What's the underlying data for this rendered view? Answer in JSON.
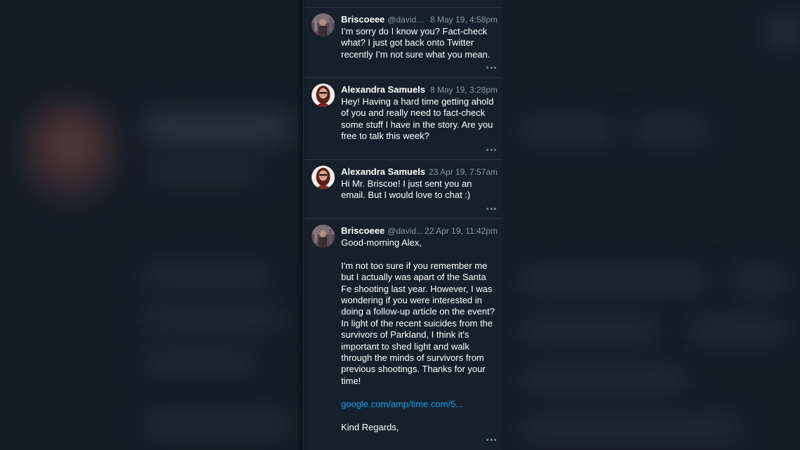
{
  "colors": {
    "background": "#15202b",
    "text": "#ffffff",
    "muted": "#8899a6",
    "link": "#1da1f2",
    "divider": "#2b3640"
  },
  "conversation": [
    {
      "name": "Briscoeee",
      "handle": "@davidd...",
      "date": "8 May 19, 4:58pm",
      "avatar": "briscoe-avatar",
      "text": "I’m sorry do I know you? Fact-check what? I just got back onto Twitter recently I’m not sure what you mean.",
      "more_icon": "more-horizontal-icon"
    },
    {
      "name": "Alexandra Samuels",
      "date": "8 May 19, 3:28pm",
      "avatar": "alexandra-avatar",
      "text": "Hey! Having a hard time getting ahold of you and really need to fact-check some stuff I have in the story. Are you free to talk this week?",
      "more_icon": "more-horizontal-icon"
    },
    {
      "name": "Alexandra Samuels",
      "date": "23 Apr 19, 7:57am",
      "avatar": "alexandra-avatar",
      "text": "Hi Mr. Briscoe! I just sent you an email. But I would love to chat :)",
      "more_icon": "more-horizontal-icon"
    },
    {
      "name": "Briscoeee",
      "handle": "@david...",
      "date": "22 Apr 19, 11:42pm",
      "avatar": "briscoe-avatar",
      "text_before_link": "Good-morning Alex,\n\nI'm not too sure if you remember me but I actually was apart of the Santa Fe shooting last year. However, I was wondering if you were interested in doing a follow-up article on the event? In light of the recent suicides from the survivors of Parkland, I think it's important to shed light and walk through the minds of survivors from previous shootings. Thanks for your time!\n\n",
      "link": "google.com/amp/time.com/5...",
      "text_after_link": "\n\nKind Regards,",
      "more_icon": "more-horizontal-icon"
    }
  ]
}
